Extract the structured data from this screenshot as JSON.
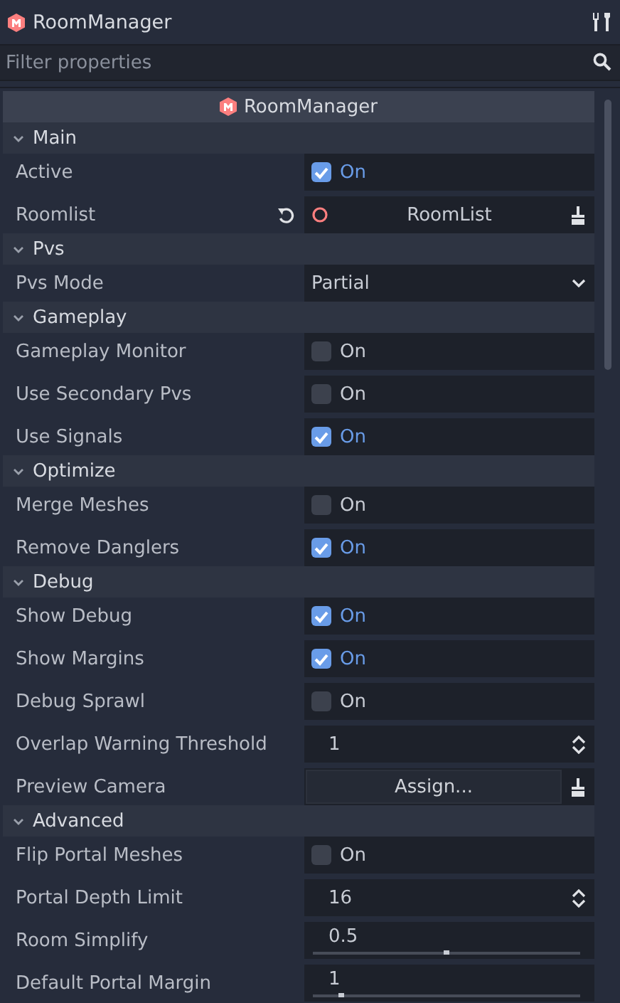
{
  "header": {
    "title": "RoomManager"
  },
  "filter": {
    "placeholder": "Filter properties"
  },
  "inspector": {
    "class_name": "RoomManager",
    "sections": [
      {
        "title": "Main",
        "expanded": true,
        "properties": [
          {
            "kind": "checkbox",
            "label": "Active",
            "checked": true,
            "text": "On"
          },
          {
            "kind": "object",
            "label": "Roomlist",
            "value": "RoomList"
          }
        ]
      },
      {
        "title": "Pvs",
        "expanded": true,
        "properties": [
          {
            "kind": "enum",
            "label": "Pvs Mode",
            "value": "Partial"
          }
        ]
      },
      {
        "title": "Gameplay",
        "expanded": true,
        "properties": [
          {
            "kind": "checkbox",
            "label": "Gameplay Monitor",
            "checked": false,
            "text": "On"
          },
          {
            "kind": "checkbox",
            "label": "Use Secondary Pvs",
            "checked": false,
            "text": "On"
          },
          {
            "kind": "checkbox",
            "label": "Use Signals",
            "checked": true,
            "text": "On"
          }
        ]
      },
      {
        "title": "Optimize",
        "expanded": true,
        "properties": [
          {
            "kind": "checkbox",
            "label": "Merge Meshes",
            "checked": false,
            "text": "On"
          },
          {
            "kind": "checkbox",
            "label": "Remove Danglers",
            "checked": true,
            "text": "On"
          }
        ]
      },
      {
        "title": "Debug",
        "expanded": true,
        "properties": [
          {
            "kind": "checkbox",
            "label": "Show Debug",
            "checked": true,
            "text": "On"
          },
          {
            "kind": "checkbox",
            "label": "Show Margins",
            "checked": true,
            "text": "On"
          },
          {
            "kind": "checkbox",
            "label": "Debug Sprawl",
            "checked": false,
            "text": "On"
          },
          {
            "kind": "spin",
            "label": "Overlap Warning Threshold",
            "value": "1"
          },
          {
            "kind": "assign",
            "label": "Preview Camera",
            "value": "Assign..."
          }
        ]
      },
      {
        "title": "Advanced",
        "expanded": true,
        "properties": [
          {
            "kind": "checkbox",
            "label": "Flip Portal Meshes",
            "checked": false,
            "text": "On"
          },
          {
            "kind": "spin",
            "label": "Portal Depth Limit",
            "value": "16"
          },
          {
            "kind": "slider",
            "label": "Room Simplify",
            "value": "0.5",
            "level": 0.5
          },
          {
            "kind": "slider",
            "label": "Default Portal Margin",
            "value": "1",
            "level": 0.1
          }
        ]
      }
    ]
  }
}
